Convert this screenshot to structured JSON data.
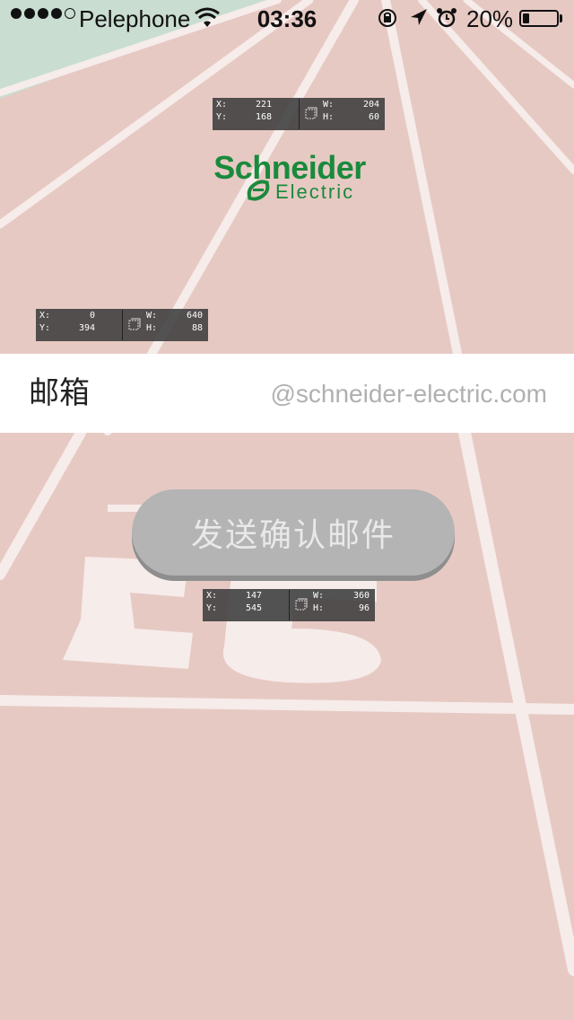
{
  "status_bar": {
    "carrier": "Pelephone",
    "time": "03:36",
    "battery_percent_text": "20%",
    "battery_level": 0.2
  },
  "logo": {
    "brand": "Schneider",
    "sub": "Electric",
    "color": "#1a8a3c"
  },
  "email": {
    "label": "邮箱",
    "placeholder": "@schneider-electric.com"
  },
  "send_button": {
    "label": "发送确认邮件"
  },
  "measurements": [
    {
      "x": "221",
      "y": "168",
      "w": "204",
      "h": "60"
    },
    {
      "x": "0",
      "y": "394",
      "w": "640",
      "h": "88"
    },
    {
      "x": "147",
      "y": "545",
      "w": "360",
      "h": "96"
    }
  ],
  "colors": {
    "track": "#e7c9c3",
    "lane_line": "#f6ecea",
    "grass": "#c9ddd1"
  }
}
